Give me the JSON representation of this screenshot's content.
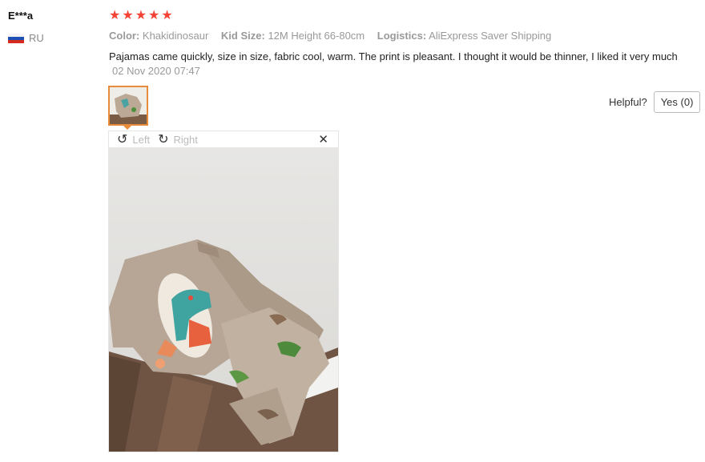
{
  "user": {
    "name": "E***a",
    "country_code": "RU"
  },
  "rating": {
    "stars": 5,
    "color": "#f44336"
  },
  "meta": {
    "color_label": "Color:",
    "color_value": "Khakidinosaur",
    "size_label": "Kid Size:",
    "size_value": "12M Height 66-80cm",
    "logistics_label": "Logistics:",
    "logistics_value": "AliExpress Saver Shipping"
  },
  "review": {
    "text": "Pajamas came quickly, size in size, fabric cool, warm. The print is pleasant. I thought it would be thinner, I liked it very much",
    "date": "02 Nov 2020 07:47"
  },
  "helpful": {
    "label": "Helpful?",
    "button": "Yes (0)"
  },
  "viewer": {
    "rotate_left": "Left",
    "rotate_right": "Right",
    "close_icon": "close-icon"
  },
  "colors": {
    "accent": "#e88b3b",
    "muted": "#999999"
  }
}
